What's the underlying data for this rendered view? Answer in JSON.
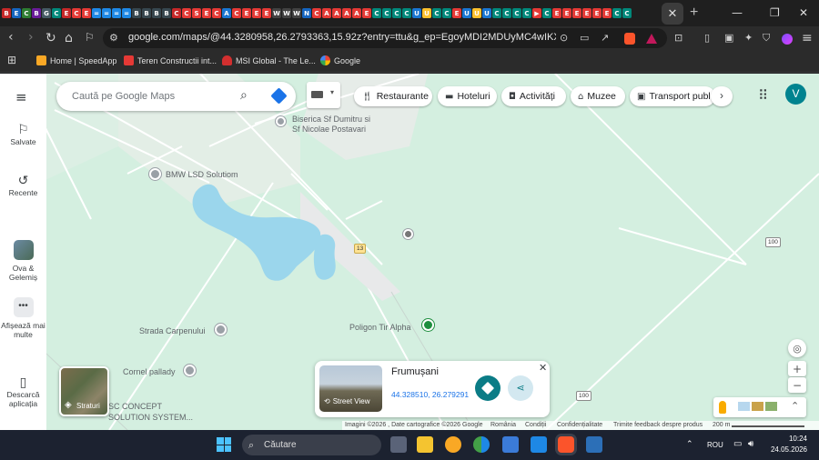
{
  "browser": {
    "tab_favicons": [
      {
        "glyph": "B",
        "color": "#c62828"
      },
      {
        "glyph": "E",
        "color": "#1565c0"
      },
      {
        "glyph": "C",
        "color": "#2e7d32"
      },
      {
        "glyph": "B",
        "color": "#6a1b9a"
      },
      {
        "glyph": "G",
        "color": "#455a64"
      },
      {
        "glyph": "C",
        "color": "#00897b"
      },
      {
        "glyph": "E",
        "color": "#c62828"
      },
      {
        "glyph": "C",
        "color": "#e53935"
      },
      {
        "glyph": "E",
        "color": "#e53935"
      },
      {
        "glyph": "=",
        "color": "#1e88e5"
      },
      {
        "glyph": "=",
        "color": "#1e88e5"
      },
      {
        "glyph": "=",
        "color": "#1e88e5"
      },
      {
        "glyph": "=",
        "color": "#1e88e5"
      },
      {
        "glyph": "B",
        "color": "#37474f"
      },
      {
        "glyph": "B",
        "color": "#37474f"
      },
      {
        "glyph": "B",
        "color": "#37474f"
      },
      {
        "glyph": "B",
        "color": "#37474f"
      },
      {
        "glyph": "C",
        "color": "#c62828"
      },
      {
        "glyph": "C",
        "color": "#e53935"
      },
      {
        "glyph": "S",
        "color": "#e53935"
      },
      {
        "glyph": "E",
        "color": "#e53935"
      },
      {
        "glyph": "C",
        "color": "#e53935"
      },
      {
        "glyph": "A",
        "color": "#1976d2"
      },
      {
        "glyph": "C",
        "color": "#e53935"
      },
      {
        "glyph": "E",
        "color": "#e53935"
      },
      {
        "glyph": "E",
        "color": "#e53935"
      },
      {
        "glyph": "E",
        "color": "#e53935"
      },
      {
        "glyph": "W",
        "color": "#424242"
      },
      {
        "glyph": "W",
        "color": "#424242"
      },
      {
        "glyph": "W",
        "color": "#424242"
      },
      {
        "glyph": "N",
        "color": "#1565c0"
      },
      {
        "glyph": "C",
        "color": "#e53935"
      },
      {
        "glyph": "A",
        "color": "#e53935"
      },
      {
        "glyph": "A",
        "color": "#e53935"
      },
      {
        "glyph": "A",
        "color": "#e53935"
      },
      {
        "glyph": "A",
        "color": "#e53935"
      },
      {
        "glyph": "E",
        "color": "#e53935"
      },
      {
        "glyph": "C",
        "color": "#00897b"
      },
      {
        "glyph": "C",
        "color": "#00897b"
      },
      {
        "glyph": "C",
        "color": "#00897b"
      },
      {
        "glyph": "C",
        "color": "#00897b"
      },
      {
        "glyph": "U",
        "color": "#1976d2"
      },
      {
        "glyph": "U",
        "color": "#fbc02d"
      },
      {
        "glyph": "C",
        "color": "#00897b"
      },
      {
        "glyph": "C",
        "color": "#00897b"
      },
      {
        "glyph": "E",
        "color": "#e53935"
      },
      {
        "glyph": "U",
        "color": "#1976d2"
      },
      {
        "glyph": "U",
        "color": "#fbc02d"
      },
      {
        "glyph": "U",
        "color": "#1976d2"
      },
      {
        "glyph": "C",
        "color": "#00897b"
      },
      {
        "glyph": "C",
        "color": "#00897b"
      },
      {
        "glyph": "C",
        "color": "#00897b"
      },
      {
        "glyph": "C",
        "color": "#00897b"
      },
      {
        "glyph": "▶",
        "color": "#e53935"
      },
      {
        "glyph": "C",
        "color": "#00897b"
      },
      {
        "glyph": "E",
        "color": "#e53935"
      },
      {
        "glyph": "E",
        "color": "#e53935"
      },
      {
        "glyph": "E",
        "color": "#e53935"
      },
      {
        "glyph": "E",
        "color": "#e53935"
      },
      {
        "glyph": "E",
        "color": "#e53935"
      },
      {
        "glyph": "E",
        "color": "#e53935"
      },
      {
        "glyph": "C",
        "color": "#00897b"
      },
      {
        "glyph": "C",
        "color": "#00897b"
      }
    ],
    "close_tab_glyph": "✕",
    "new_tab_glyph": "+",
    "url": "google.com/maps/@44.3280958,26.2793363,15.92z?entry=ttu&g_ep=EgoyMDI2MDUyMC4wIKXMDSoAS...",
    "bookmarks": [
      {
        "label": "Home | SpeedApp",
        "color": "#f9a825"
      },
      {
        "label": "Teren Constructii int...",
        "color": "#e53935"
      },
      {
        "label": "MSI Global - The Le...",
        "color": "#d32f2f"
      },
      {
        "label": "Google",
        "color": "#4285f4"
      }
    ]
  },
  "maps": {
    "rail": [
      {
        "label": "Salvate",
        "icon": "bookmark-icon"
      },
      {
        "label": "Recente",
        "icon": "history-icon"
      },
      {
        "label": "Ova & Gelemiș",
        "icon": "thumbnail"
      },
      {
        "label": "Afișează mai multe",
        "icon": "more-icon"
      },
      {
        "label": "Descarcă aplicația",
        "icon": "phone-icon"
      }
    ],
    "search_placeholder": "Caută pe Google Maps",
    "chips": [
      "Restaurante",
      "Hoteluri",
      "Activități",
      "Muzee",
      "Transport publ"
    ],
    "account_initial": "V",
    "map_labels": {
      "church": "Biserica Sf Dumitru si\nSf Nicolae Postavari",
      "bmw": "BMW LSD Solutiom",
      "carpenului": "Strada Carpenului",
      "poligon": "Poligon Tir Alpha",
      "cornel": "Cornel pallady",
      "concept": "SC CONCEPT\nSOLUTION SYSTEM..."
    },
    "road_shields": [
      "13",
      "100",
      "100"
    ],
    "layers_label": "Straturi",
    "info_card": {
      "title": "Frumușani",
      "coords": "44.328510, 26.279291",
      "street_view": "Street View"
    },
    "attribution": [
      "Imagini ©2026 , Date cartografice ©2026 Google",
      "România",
      "Condiții",
      "Confidențialitate",
      "Trimite feedback despre produs",
      "200 m"
    ]
  },
  "taskbar": {
    "search_placeholder": "Căutare",
    "lang": "ROU",
    "time": "10:24",
    "date": "24.05.2026"
  }
}
